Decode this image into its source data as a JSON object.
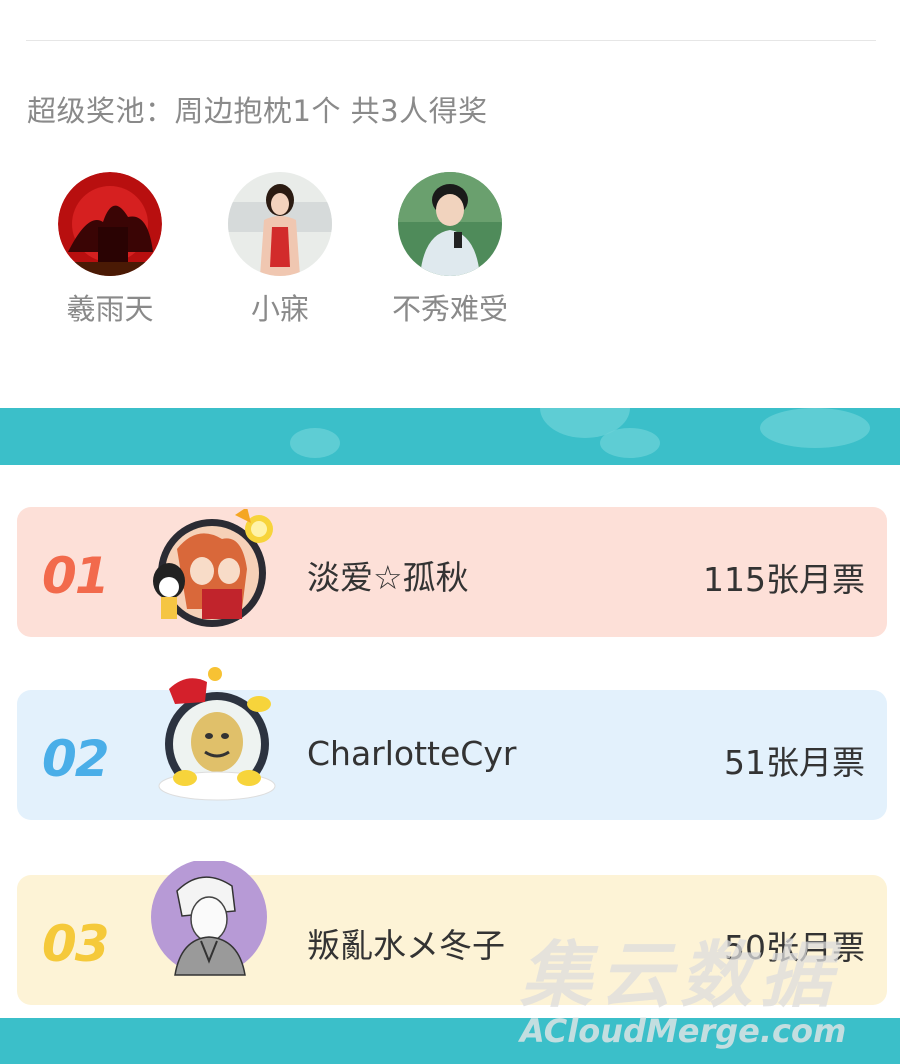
{
  "pool": {
    "title": "超级奖池：周边抱枕1个 共3人得奖",
    "winners": [
      {
        "name": "羲雨天"
      },
      {
        "name": "小寐"
      },
      {
        "name": "不秀难受"
      }
    ]
  },
  "ranking": [
    {
      "rank": "01",
      "name": "淡爱☆孤秋",
      "votes": "115张月票",
      "card_color": "#fde0d8",
      "rank_color": "#f26a4c"
    },
    {
      "rank": "02",
      "name": "CharlotteCyr",
      "votes": "51张月票",
      "card_color": "#e3f1fc",
      "rank_color": "#4aaee8"
    },
    {
      "rank": "03",
      "name": "叛亂水メ冬子",
      "votes": "50张月票",
      "card_color": "#fdf3d6",
      "rank_color": "#f5c93a"
    }
  ],
  "watermark": {
    "cn": "集云数据",
    "en": "ACloudMerge.com"
  }
}
